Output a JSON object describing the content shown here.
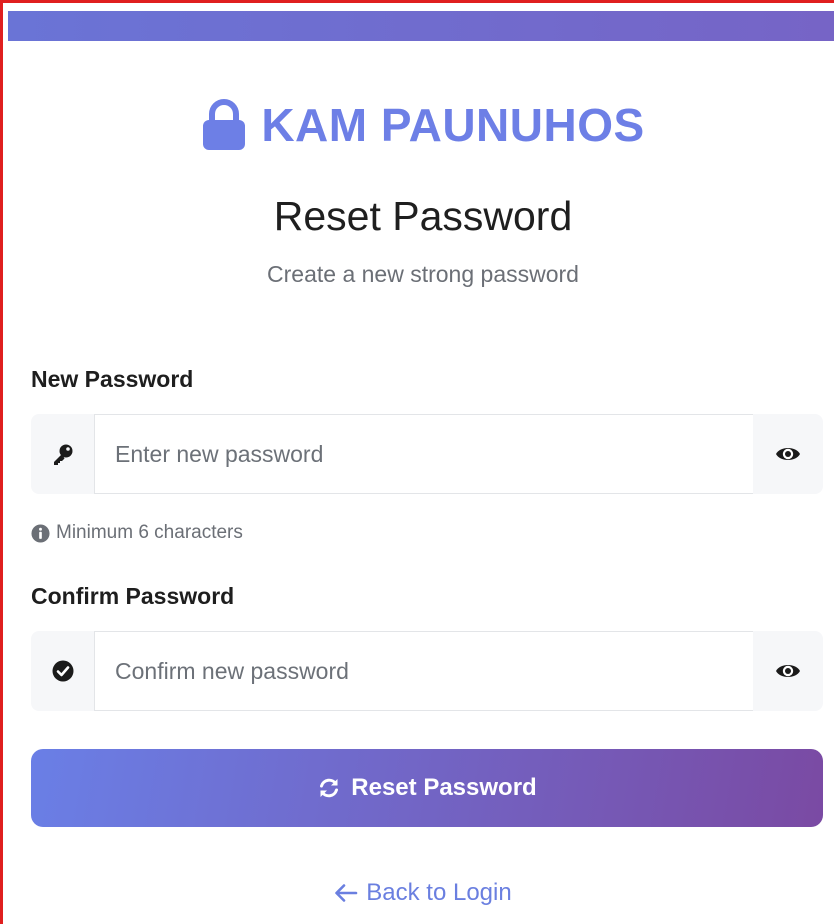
{
  "colors": {
    "accent": "#6d7fe6",
    "gradient_start": "#6a7fe6",
    "gradient_end": "#7a4aa3",
    "window_border": "#e01f1f"
  },
  "brand": {
    "icon": "lock-icon",
    "name": "KAM PAUNUHOS"
  },
  "header": {
    "title": "Reset Password",
    "subtitle": "Create a new strong password"
  },
  "form": {
    "new_password": {
      "label": "New Password",
      "placeholder": "Enter new password",
      "value": "",
      "left_icon": "key-icon",
      "toggle_icon": "eye-icon",
      "hint": "Minimum 6 characters",
      "hint_icon": "info-icon"
    },
    "confirm_password": {
      "label": "Confirm Password",
      "placeholder": "Confirm new password",
      "value": "",
      "left_icon": "check-circle-icon",
      "toggle_icon": "eye-icon"
    },
    "submit": {
      "label": "Reset Password",
      "icon": "refresh-icon"
    }
  },
  "footer": {
    "back_link": "Back to Login",
    "back_icon": "arrow-left-icon"
  }
}
